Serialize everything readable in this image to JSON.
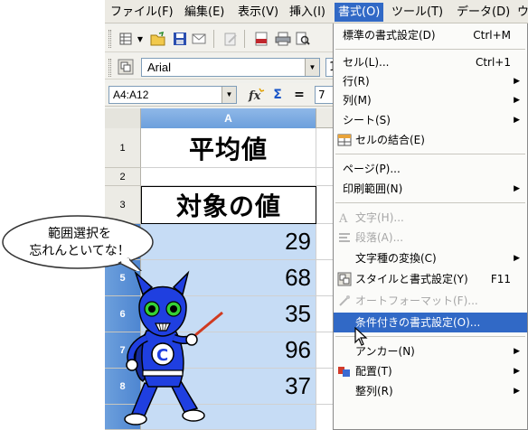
{
  "menubar": {
    "items": [
      {
        "label": "ファイル(F)"
      },
      {
        "label": "編集(E)"
      },
      {
        "label": "表示(V)"
      },
      {
        "label": "挿入(I)"
      },
      {
        "label": "書式(O)"
      },
      {
        "label": "ツール(T)"
      },
      {
        "label": "データ(D)"
      },
      {
        "label": "ウ"
      }
    ],
    "active_index": 4
  },
  "toolbar": {
    "font_name": "Arial",
    "font_size": "1"
  },
  "formula_bar": {
    "name_box": "A4:A12",
    "input_value": "7"
  },
  "sheet": {
    "column_headers": [
      "A"
    ],
    "rows": [
      {
        "row": "1",
        "value": "平均値"
      },
      {
        "row": "2",
        "value": ""
      },
      {
        "row": "3",
        "value": "対象の値"
      },
      {
        "row": "4",
        "value": "29"
      },
      {
        "row": "5",
        "value": "68"
      },
      {
        "row": "6",
        "value": "35"
      },
      {
        "row": "7",
        "value": "96"
      },
      {
        "row": "8",
        "value": "37"
      }
    ]
  },
  "format_menu": {
    "items": [
      {
        "label": "標準の書式設定(D)",
        "shortcut": "Ctrl+M"
      },
      {
        "label": "セル(L)...",
        "shortcut": "Ctrl+1"
      },
      {
        "label": "行(R)"
      },
      {
        "label": "列(M)"
      },
      {
        "label": "シート(S)"
      },
      {
        "label": "セルの結合(E)"
      },
      {
        "label": "ページ(P)..."
      },
      {
        "label": "印刷範囲(N)"
      },
      {
        "label": "文字(H)..."
      },
      {
        "label": "段落(A)..."
      },
      {
        "label": "文字種の変換(C)"
      },
      {
        "label": "スタイルと書式設定(Y)",
        "shortcut": "F11"
      },
      {
        "label": "オートフォーマット(F)..."
      },
      {
        "label": "条件付きの書式設定(O)..."
      },
      {
        "label": "アンカー(N)"
      },
      {
        "label": "配置(T)"
      },
      {
        "label": "整列(R)"
      }
    ]
  },
  "mascot_bubble": {
    "line1": "範囲選択を",
    "line2": "忘れんといてな！"
  },
  "colors": {
    "menu_highlight": "#3169c6",
    "selection_fill": "#c6dcf5",
    "mascot_body": "#1f3fe0"
  }
}
